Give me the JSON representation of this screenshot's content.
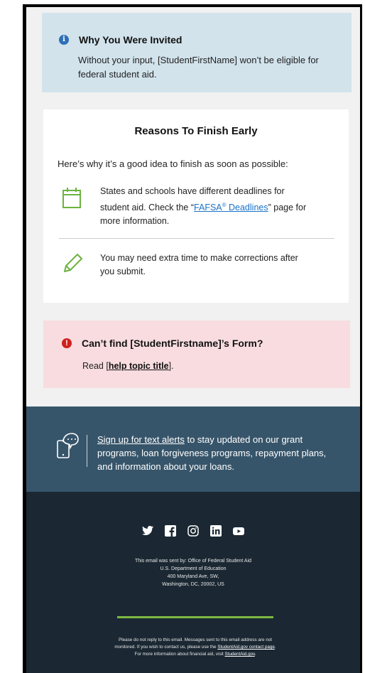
{
  "invited": {
    "title": "Why You Were Invited",
    "body": "Without your input, [StudentFirstName] won’t be eligible for federal student aid."
  },
  "reasons": {
    "title": "Reasons To Finish Early",
    "intro": "Here’s why it’s a good idea to finish as soon as possible:",
    "item1": {
      "pre": "States and schools have different deadlines for student aid. Check the “",
      "link_main": "FAFSA",
      "link_sup": "®",
      "link_rest": " Deadlines",
      "post": "” page for more information."
    },
    "item2": {
      "text": "You may need extra time to make corrections after you submit."
    }
  },
  "cant_find": {
    "title": "Can’t find [StudentFirstname]’s Form?",
    "pre": "Read [",
    "link": "help topic title",
    "post": "]."
  },
  "text_alerts": {
    "link": "Sign up for text alerts",
    "rest": " to stay updated on our grant programs, loan forgiveness programs, repayment plans, and information about your loans."
  },
  "footer": {
    "social_icons": [
      "twitter-icon",
      "facebook-icon",
      "instagram-icon",
      "linkedin-icon",
      "youtube-icon"
    ],
    "sent_by": [
      "This email was sent by: Office of Federal Student Aid",
      "U.S. Department of Education",
      "400 Maryland Ave, SW,",
      "Washington, DC, 20002, US"
    ],
    "disclaimer_pre": "Please do not reply to this email. Messages sent to this email address are not monitored. If you wish to contact us, please use the ",
    "disclaimer_link1": "StudentAid.gov contact page",
    "disclaimer_mid": ". For more information about financial aid, visit ",
    "disclaimer_link2": "StudentAid.gov",
    "disclaimer_post": "."
  },
  "colors": {
    "info_bg": "#d2e3ec",
    "alert_bg": "#f8dcdf",
    "alerts_banner": "#37556a",
    "footer_bg": "#1b2833",
    "accent_green": "#7db743",
    "link_blue": "#1a73c8"
  }
}
